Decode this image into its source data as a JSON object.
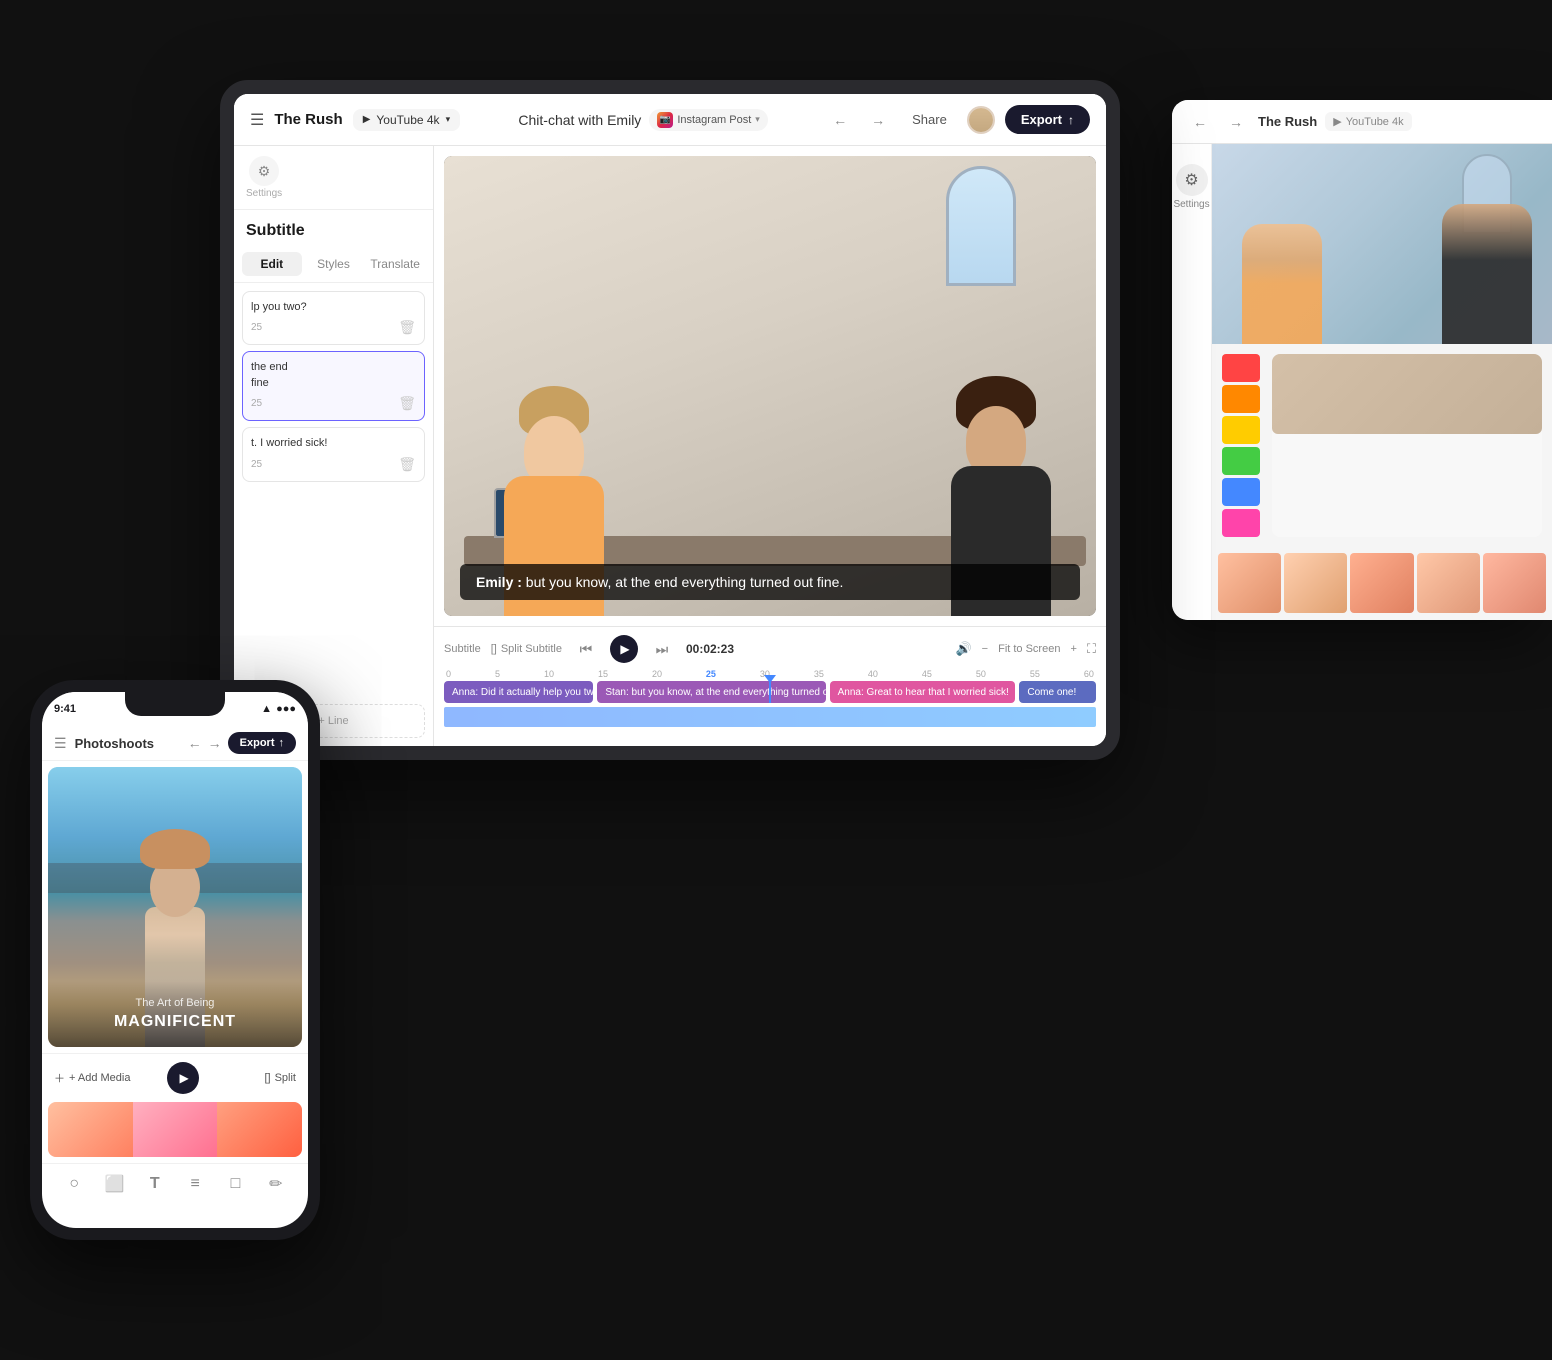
{
  "scene": {
    "bg_color": "#0a0a0a"
  },
  "tablet": {
    "topbar": {
      "menu_icon": "☰",
      "title": "The Rush",
      "project_format": "YouTube 4k",
      "project_icon": "▶",
      "undo_icon": "←",
      "redo_icon": "→",
      "share_label": "Share",
      "export_label": "Export",
      "upload_icon": "↑"
    },
    "project_name": "Chit-chat with Emily",
    "social_format": "Instagram Post",
    "sidebar": {
      "title": "Subtitle",
      "menu_icon": "☰",
      "settings_icon": "⚙",
      "settings_label": "Settings",
      "tabs": [
        "Edit",
        "Styles",
        "Translate"
      ],
      "active_tab": "Edit",
      "subtitles": [
        {
          "text": "lp you two?",
          "time": "25",
          "active": false
        },
        {
          "text": "the end\nfine",
          "time": "25",
          "active": true
        },
        {
          "text": "t. I worried sick!",
          "time": "25",
          "active": false
        },
        {
          "text": "+ Line",
          "active": false,
          "is_add": true
        }
      ]
    },
    "video": {
      "subtitle_speaker": "Emily :",
      "subtitle_text": " but you know, at the end everything turned out fine."
    },
    "timeline": {
      "subtitle_label": "Subtitle",
      "split_label": "Split Subtitle",
      "fit_screen_label": "Fit to Screen",
      "fullscreen_icon": "⛶",
      "time_display": "00:02:23",
      "play_icon": "▶",
      "prev_icon": "⏮",
      "next_icon": "⏭",
      "volume_icon": "🔊",
      "ruler": [
        "0",
        "5",
        "10",
        "15",
        "20",
        "25",
        "30",
        "35",
        "40",
        "45",
        "50",
        "55",
        "60"
      ],
      "tracks": [
        {
          "text": "Anna: Did it actually help you two?",
          "color": "purple"
        },
        {
          "text": "Stan: but you know, at the end everything turned out fine",
          "color": "violet"
        },
        {
          "text": "Anna: Great to hear that I worried sick!",
          "color": "pink"
        },
        {
          "text": "Come one!",
          "color": "indigo"
        }
      ]
    }
  },
  "phone": {
    "status": {
      "time": "9:41",
      "battery": "●●●",
      "wifi": "▲"
    },
    "topbar": {
      "back_icon": "←",
      "forward_icon": "→",
      "project_name": "Photoshoots",
      "export_label": "Export",
      "upload_icon": "↑"
    },
    "video": {
      "subtitle1": "The Art of Being",
      "subtitle2": "MAGNIFICENT"
    },
    "controls": {
      "add_media": "+ Add Media",
      "play_icon": "▶",
      "split_icon": "[]",
      "split_label": "Split"
    },
    "bottom_icons": [
      "○",
      "⬜",
      "T",
      "≡",
      "□",
      "✏"
    ]
  },
  "desktop": {
    "topbar": {
      "back_icon": "←",
      "forward_icon": "→",
      "title": "The Rush",
      "format": "YouTube 4k"
    },
    "settings": {
      "icon": "⚙",
      "label": "Settings"
    },
    "color_swatches": [
      "#ff4444",
      "#ff8800",
      "#ffcc00",
      "#44cc44",
      "#4488ff",
      "#ff44aa"
    ],
    "photo_strip": [
      "photo1",
      "photo2",
      "photo3",
      "photo4",
      "photo5"
    ]
  }
}
